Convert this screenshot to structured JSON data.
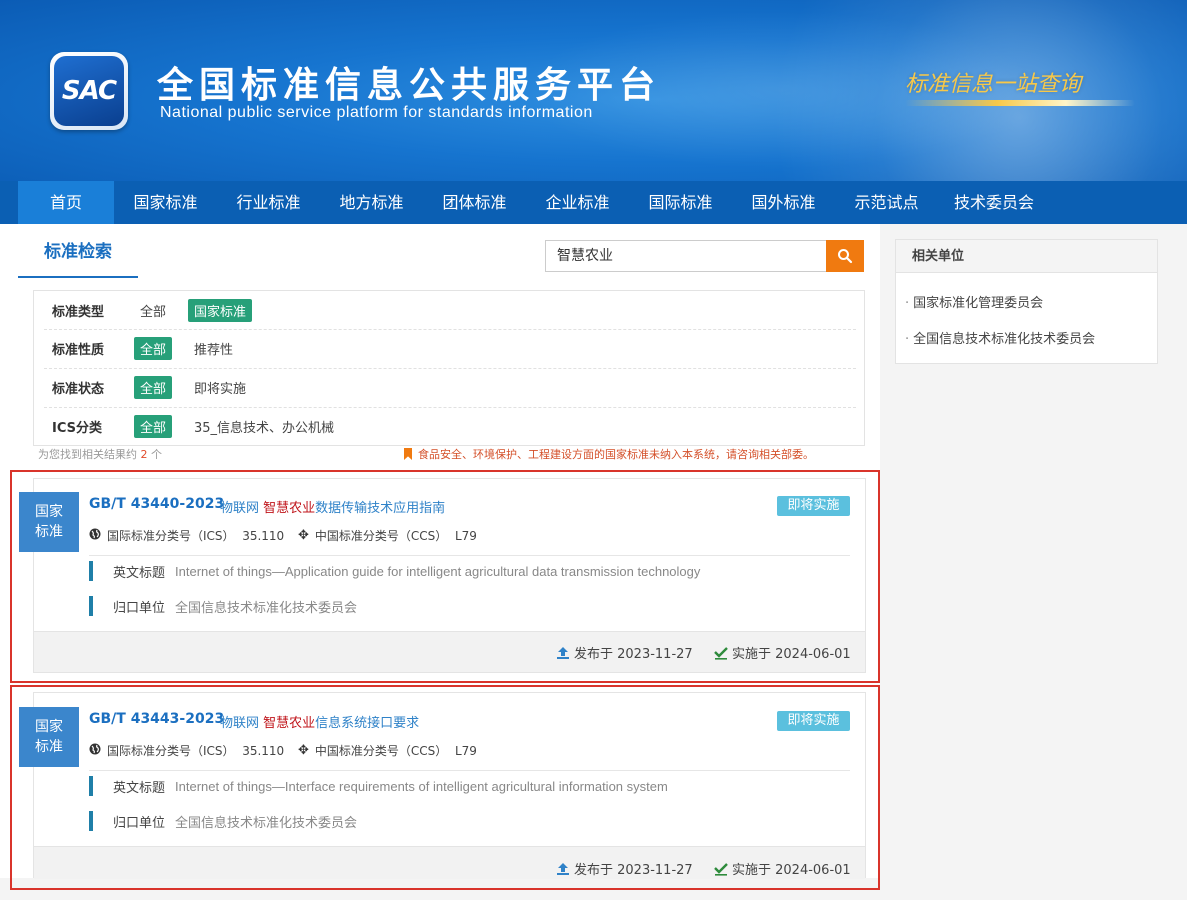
{
  "header": {
    "logo_text": "SAC",
    "title": "全国标准信息公共服务平台",
    "subtitle": "National public service platform  for standards information",
    "slogan": "标准信息一站查询"
  },
  "nav": {
    "items": [
      "首页",
      "国家标准",
      "行业标准",
      "地方标准",
      "团体标准",
      "企业标准",
      "国际标准",
      "国外标准",
      "示范试点",
      "技术委员会"
    ]
  },
  "search": {
    "section_title": "标准检索",
    "query": "智慧农业"
  },
  "filters": [
    {
      "label": "标准类型",
      "all": "全部",
      "selected": "国家标准"
    },
    {
      "label": "标准性质",
      "all": "全部",
      "selected": "推荐性"
    },
    {
      "label": "标准状态",
      "all": "全部",
      "selected": "即将实施"
    },
    {
      "label": "ICS分类",
      "all": "全部",
      "selected": "35_信息技术、办公机械"
    }
  ],
  "results_summary": {
    "prefix": "为您找到相关结果约",
    "count": "2",
    "suffix": "个",
    "notice": "食品安全、环境保护、工程建设方面的国家标准未纳入本系统，请咨询相关部委。"
  },
  "results": [
    {
      "badge": [
        "国家",
        "标准"
      ],
      "number": "GB/T 43440-2023",
      "title_pre": "物联网",
      "title_kw": "智慧农业",
      "title_post": "数据传输技术应用指南",
      "status": "即将实施",
      "ics_label": "国际标准分类号（ICS）",
      "ics": "35.110",
      "ccs_label": "中国标准分类号（CCS）",
      "ccs": "L79",
      "en_label": "英文标题",
      "en_title": "Internet of things—Application guide for intelligent agricultural data transmission technology",
      "org_label": "归口单位",
      "org": "全国信息技术标准化技术委员会",
      "publish": "发布于 2023-11-27",
      "implement": "实施于 2024-06-01"
    },
    {
      "badge": [
        "国家",
        "标准"
      ],
      "number": "GB/T 43443-2023",
      "title_pre": "物联网",
      "title_kw": "智慧农业",
      "title_post": "信息系统接口要求",
      "status": "即将实施",
      "ics_label": "国际标准分类号（ICS）",
      "ics": "35.110",
      "ccs_label": "中国标准分类号（CCS）",
      "ccs": "L79",
      "en_label": "英文标题",
      "en_title": "Internet of things—Interface requirements of intelligent agricultural information system",
      "org_label": "归口单位",
      "org": "全国信息技术标准化技术委员会",
      "publish": "发布于 2023-11-27",
      "implement": "实施于 2024-06-01"
    }
  ],
  "sidebar": {
    "title": "相关单位",
    "items": [
      "国家标准化管理委员会",
      "全国信息技术标准化技术委员会"
    ]
  },
  "colors": {
    "brand_blue": "#0b5fb3",
    "tag_green": "#27a079",
    "status_blue": "#5bc0de",
    "search_orange": "#f07a10",
    "highlight_red": "#d9342b"
  }
}
